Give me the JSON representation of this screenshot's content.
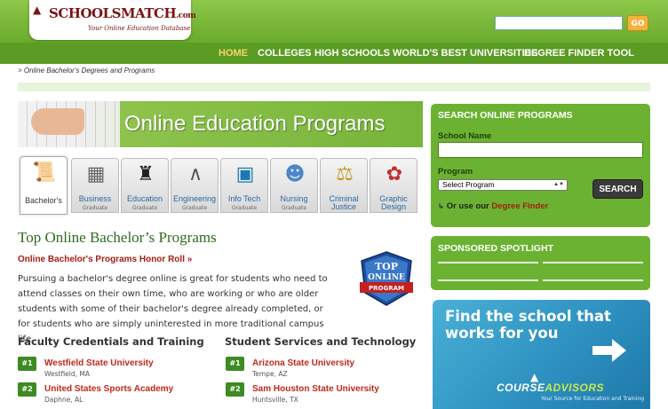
{
  "header": {
    "logo_text": "SCHOOLSMATCH",
    "logo_dotcom": ".com",
    "logo_tagline": "Your Online Education Database",
    "search_placeholder": "",
    "go_label": "GO"
  },
  "nav": {
    "items": [
      {
        "label": "HOME",
        "active": true
      },
      {
        "label": "COLLEGES",
        "active": false
      },
      {
        "label": "HIGH SCHOOLS",
        "active": false
      },
      {
        "label": "WORLD'S BEST UNIVERSITIES",
        "active": false
      },
      {
        "label": "DEGREE FINDER TOOL",
        "active": false
      }
    ]
  },
  "breadcrumb": {
    "text": "> Online Bachelor's Degrees and Programs"
  },
  "banner": {
    "title": "Online Education Programs"
  },
  "tabs": [
    {
      "label": "Bachelor's",
      "sub": "",
      "icon": "diploma-icon"
    },
    {
      "label": "Business",
      "sub": "Graduate",
      "icon": "calculator-icon"
    },
    {
      "label": "Education",
      "sub": "Graduate",
      "icon": "graduate-icon"
    },
    {
      "label": "Engineering",
      "sub": "Graduate",
      "icon": "compass-icon"
    },
    {
      "label": "Info Tech",
      "sub": "Graduate",
      "icon": "monitor-icon"
    },
    {
      "label": "Nursing",
      "sub": "Graduate",
      "icon": "nurse-icon"
    },
    {
      "label": "Criminal",
      "label2": "Justice",
      "sub": "",
      "icon": "scales-icon"
    },
    {
      "label": "Graphic",
      "label2": "Design",
      "sub": "",
      "icon": "palette-icon"
    }
  ],
  "main": {
    "heading": "Top Online Bachelor’s Programs",
    "honor_roll_link": "Online Bachelor's Programs Honor Roll »",
    "intro": "Pursuing a bachelor's degree online is great for students who need to attend classes on their own time, who are working or who are older students with some of their bachelor's degree already completed, or for students who are simply uninterested in more traditional campus life.",
    "badge": {
      "line1": "TOP",
      "line2": "ONLINE",
      "line3": "PROGRAM"
    }
  },
  "columns": [
    {
      "heading": "Faculty Credentials and Training",
      "schools": [
        {
          "rank": "#1",
          "name": "Westfield State University",
          "location": "Westfield, MA"
        },
        {
          "rank": "#2",
          "name": "United States Sports Academy",
          "location": "Daphne, AL"
        }
      ]
    },
    {
      "heading": "Student Services and Technology",
      "schools": [
        {
          "rank": "#1",
          "name": "Arizona State University",
          "location": "Tempe, AZ"
        },
        {
          "rank": "#2",
          "name": "Sam Houston State University",
          "location": "Huntsville, TX"
        }
      ]
    }
  ],
  "search_panel": {
    "title": "SEARCH ONLINE PROGRAMS",
    "school_name_label": "School Name",
    "program_label": "Program",
    "program_selected": "Select Program",
    "search_button": "SEARCH",
    "or_use_text": "Or use our",
    "degree_finder_link": "Degree Finder"
  },
  "spotlight": {
    "title": "SPONSORED SPOTLIGHT"
  },
  "ad": {
    "title": "Find the school that works for you",
    "brand_course": "COURSE",
    "brand_advisors": "ADVISORS",
    "tagline": "Your Source for Education and Training"
  },
  "colors": {
    "header_green": "#6aaa2c",
    "nav_green": "#5b9c24",
    "panel_green": "#6bb232",
    "link_red": "#c0281a",
    "heading_green": "#2e6b1e",
    "active_nav": "#f8d36a",
    "go_orange": "#f3b23a"
  }
}
